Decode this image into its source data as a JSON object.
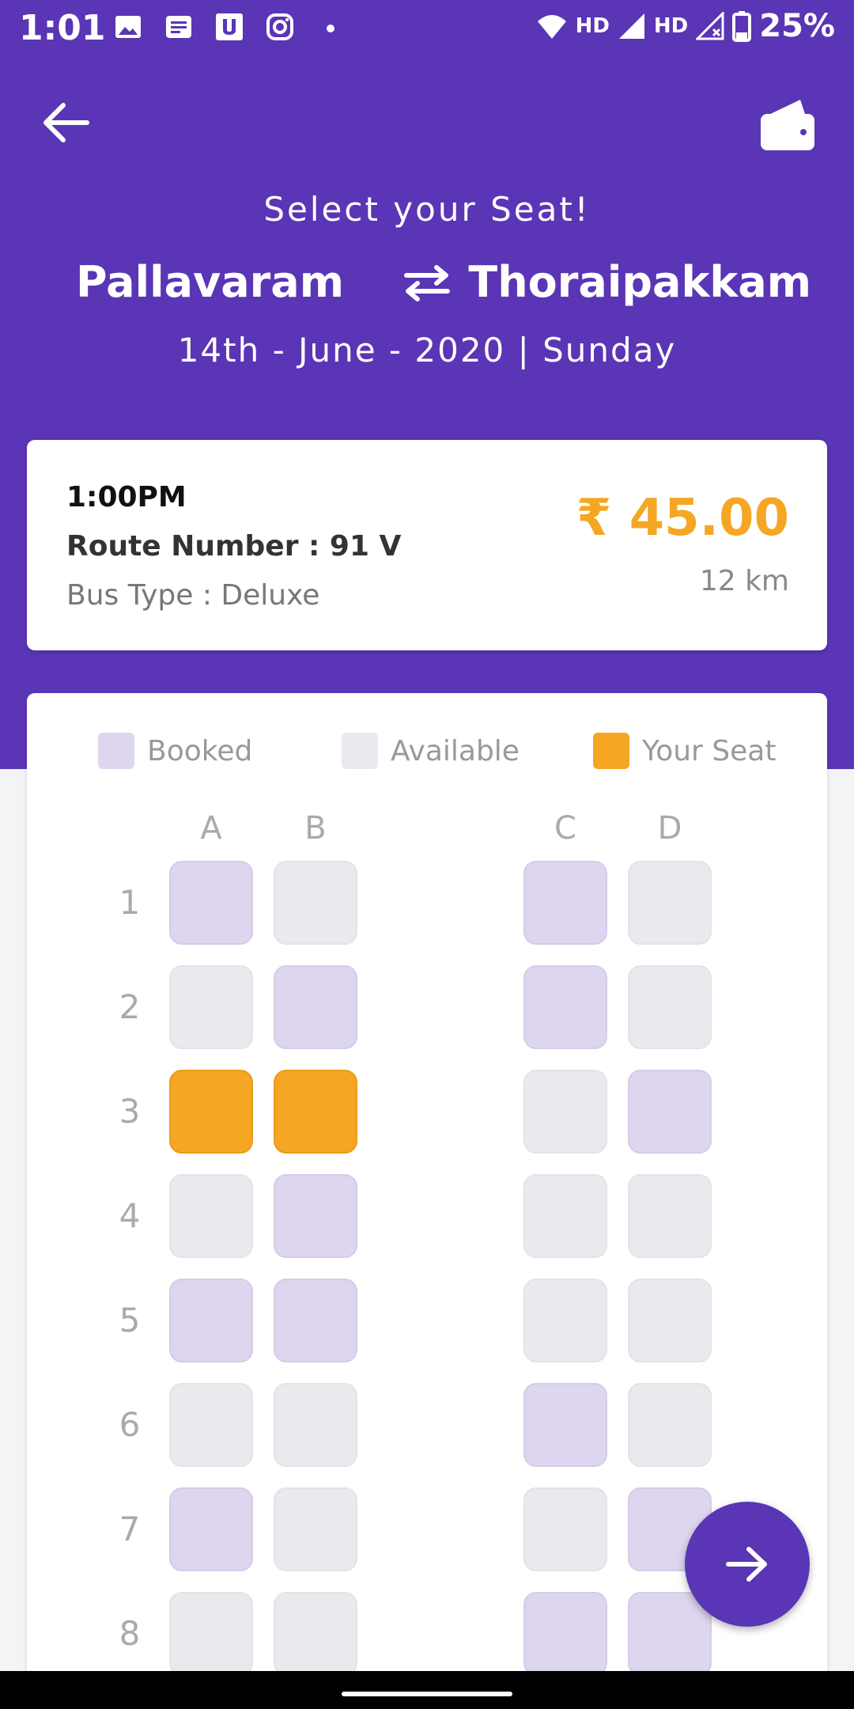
{
  "status_bar": {
    "time": "1:01",
    "network_1": "HD",
    "network_2": "HD",
    "battery": "25%"
  },
  "header": {
    "title": "Select your Seat!",
    "from_city": "Pallavaram",
    "to_city": "Thoraipakkam",
    "date": "14th - June - 2020 | Sunday"
  },
  "trip": {
    "departure_time": "1:00PM",
    "route_number": "Route Number : 91 V",
    "bus_type": "Bus Type : Deluxe",
    "fare": "₹ 45.00",
    "distance": "12 km"
  },
  "legend": {
    "booked": "Booked",
    "available": "Available",
    "your_seat": "Your Seat"
  },
  "seat_map": {
    "columns": [
      "A",
      "B",
      "C",
      "D"
    ],
    "rows": [
      {
        "label": "1",
        "seats": [
          "booked",
          "available",
          "booked",
          "available"
        ]
      },
      {
        "label": "2",
        "seats": [
          "available",
          "booked",
          "booked",
          "available"
        ]
      },
      {
        "label": "3",
        "seats": [
          "mine",
          "mine",
          "available",
          "booked"
        ]
      },
      {
        "label": "4",
        "seats": [
          "available",
          "booked",
          "available",
          "available"
        ]
      },
      {
        "label": "5",
        "seats": [
          "booked",
          "booked",
          "available",
          "available"
        ]
      },
      {
        "label": "6",
        "seats": [
          "available",
          "available",
          "booked",
          "available"
        ]
      },
      {
        "label": "7",
        "seats": [
          "booked",
          "available",
          "available",
          "booked"
        ]
      },
      {
        "label": "8",
        "seats": [
          "available",
          "available",
          "booked",
          "booked"
        ]
      }
    ]
  },
  "colors": {
    "primary": "#5a35b5",
    "accent": "#f5a623",
    "booked": "#ddd6ee",
    "available": "#e9e9ee"
  },
  "icons": {
    "back": "arrow-left-icon",
    "wallet": "wallet-icon",
    "swap": "swap-arrows-icon",
    "next": "arrow-right-icon"
  }
}
